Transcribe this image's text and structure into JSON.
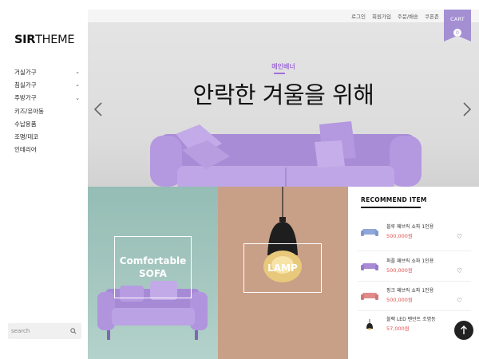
{
  "brand": {
    "logo_bold": "SIR",
    "logo_rest": "THEME"
  },
  "sidebar": {
    "items": [
      {
        "label": "거실가구",
        "has_submenu": true
      },
      {
        "label": "침실가구",
        "has_submenu": true
      },
      {
        "label": "주방가구",
        "has_submenu": true
      },
      {
        "label": "키즈/유아동",
        "has_submenu": false
      },
      {
        "label": "수납용품",
        "has_submenu": false
      },
      {
        "label": "조명/데코",
        "has_submenu": false
      },
      {
        "label": "인테리어",
        "has_submenu": false
      }
    ],
    "search_placeholder": "search"
  },
  "topbar": {
    "links": [
      "로그인",
      "회원가입",
      "주문/배송",
      "쿠폰존"
    ],
    "cart_label": "CART",
    "cart_count": "0"
  },
  "hero": {
    "subtitle": "메인배너",
    "title": "안락한 겨울을 위해"
  },
  "tiles": {
    "sofa_line1": "Comfortable",
    "sofa_line2": "SOFA",
    "lamp_label": "LAMP"
  },
  "recommend": {
    "title": "RECOMMEND ITEM",
    "items": [
      {
        "name": "블루 패브릭 쇼파 1인용",
        "price": "500,000원",
        "thumb_icon": "blue-sofa-icon",
        "color": "#8fa6d8"
      },
      {
        "name": "퍼플 패브릭 쇼파 1인용",
        "price": "500,000원",
        "thumb_icon": "purple-sofa-icon",
        "color": "#a98ad6"
      },
      {
        "name": "핑크 패브릭 쇼파 1인용",
        "price": "500,000원",
        "thumb_icon": "pink-sofa-icon",
        "color": "#e08a8a"
      },
      {
        "name": "블랙 LED 펜던트 조명등",
        "price": "57,000원",
        "thumb_icon": "pendant-lamp-icon",
        "color": "#222222"
      }
    ]
  },
  "colors": {
    "accent": "#a48fd3",
    "price": "#e05050",
    "sofa_purple": "#b49ae0",
    "tile_teal": "#9fc4bc",
    "tile_tan": "#c8a088"
  }
}
